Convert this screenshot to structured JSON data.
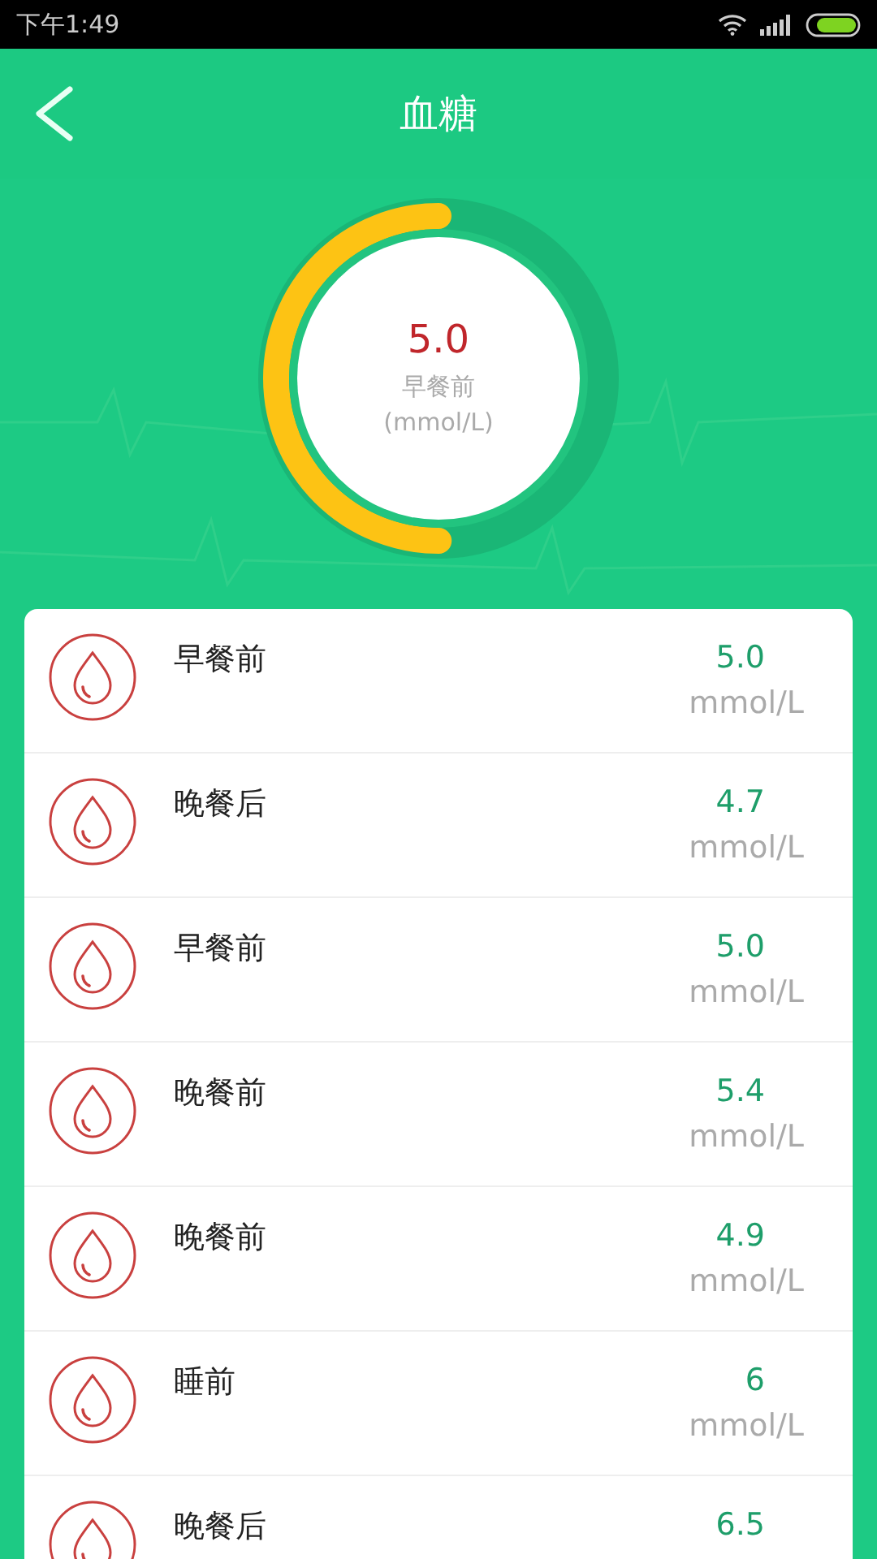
{
  "status_bar": {
    "time": "下午1:49"
  },
  "header": {
    "title": "血糖"
  },
  "gauge": {
    "value": "5.0",
    "label": "早餐前",
    "unit": "(mmol/L)",
    "level": 0.5
  },
  "records": [
    {
      "label": "早餐前",
      "value": "5.0",
      "unit": "mmol/L"
    },
    {
      "label": "晚餐后",
      "value": "4.7",
      "unit": "mmol/L"
    },
    {
      "label": "早餐前",
      "value": "5.0",
      "unit": "mmol/L"
    },
    {
      "label": "晚餐前",
      "value": "5.4",
      "unit": "mmol/L"
    },
    {
      "label": "晚餐前",
      "value": "4.9",
      "unit": "mmol/L"
    },
    {
      "label": "睡前",
      "value": "6",
      "unit": "mmol/L"
    },
    {
      "label": "晚餐后",
      "value": "6.5"
    }
  ]
}
